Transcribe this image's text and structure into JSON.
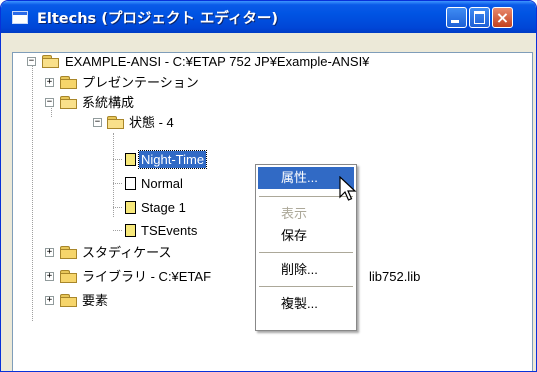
{
  "window": {
    "title": "Eltechs (プロジェクト エディター)",
    "controls": {
      "minimize": "minimize",
      "maximize": "maximize",
      "close": "×"
    }
  },
  "tree": {
    "root": {
      "label": "EXAMPLE-ANSI - C:¥ETAP 752 JP¥Example-ANSI¥",
      "expander": "−"
    },
    "presentation": {
      "label": "プレゼンテーション",
      "expander": "+"
    },
    "system": {
      "label": "系統構成",
      "expander": "−"
    },
    "state": {
      "label": "状態 - 4",
      "expander": "−"
    },
    "states": [
      "Night-Time",
      "Normal",
      "Stage 1",
      "TSEvents"
    ],
    "study_case": {
      "label": "スタディケース",
      "expander": "+"
    },
    "library": {
      "label_left": "ライブラリ - C:¥ETAF",
      "label_right": "lib752.lib",
      "expander": "+"
    },
    "elements": {
      "label": "要素",
      "expander": "+"
    }
  },
  "context_menu": {
    "items": [
      "属性...",
      "表示",
      "保存",
      "削除...",
      "複製..."
    ],
    "highlighted": "属性...",
    "disabled": [
      "表示"
    ]
  },
  "colors": {
    "title_bar": "#0054e3",
    "selection": "#316ac5",
    "close_button": "#c2401f"
  }
}
